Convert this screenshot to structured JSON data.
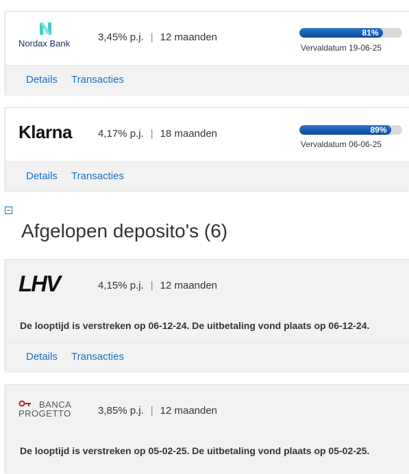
{
  "active_deposits": [
    {
      "bank": "Nordax Bank",
      "rate": "3,45% p.j.",
      "term": "12 maanden",
      "progress_percent": 81,
      "progress_label": "81%",
      "due_date": "Vervaldatum 19-06-25",
      "details_label": "Details",
      "transactions_label": "Transacties"
    },
    {
      "bank": "Klarna",
      "rate": "4,17% p.j.",
      "term": "18 maanden",
      "progress_percent": 89,
      "progress_label": "89%",
      "due_date": "Vervaldatum 06-06-25",
      "details_label": "Details",
      "transactions_label": "Transacties"
    }
  ],
  "expired_section": {
    "title": "Afgelopen deposito's (6)"
  },
  "expired_deposits": [
    {
      "bank": "LHV",
      "rate": "4,15% p.j.",
      "term": "12 maanden",
      "expiry_text": "De looptijd is verstreken op 06-12-24. De uitbetaling vond plaats op 06-12-24.",
      "details_label": "Details",
      "transactions_label": "Transacties"
    },
    {
      "bank_line1": "BANCA",
      "bank_line2": "PROGETTO",
      "rate": "3,85% p.j.",
      "term": "12 maanden",
      "expiry_text": "De looptijd is verstreken op 05-02-25. De uitbetaling vond plaats op 05-02-25."
    }
  ],
  "colors": {
    "link": "#1b6ec2",
    "progress_fill": "#0d4a98",
    "nordax_teal": "#3fd0c6",
    "nordax_navy": "#1e2f5a",
    "progetto_red": "#b0202e"
  }
}
